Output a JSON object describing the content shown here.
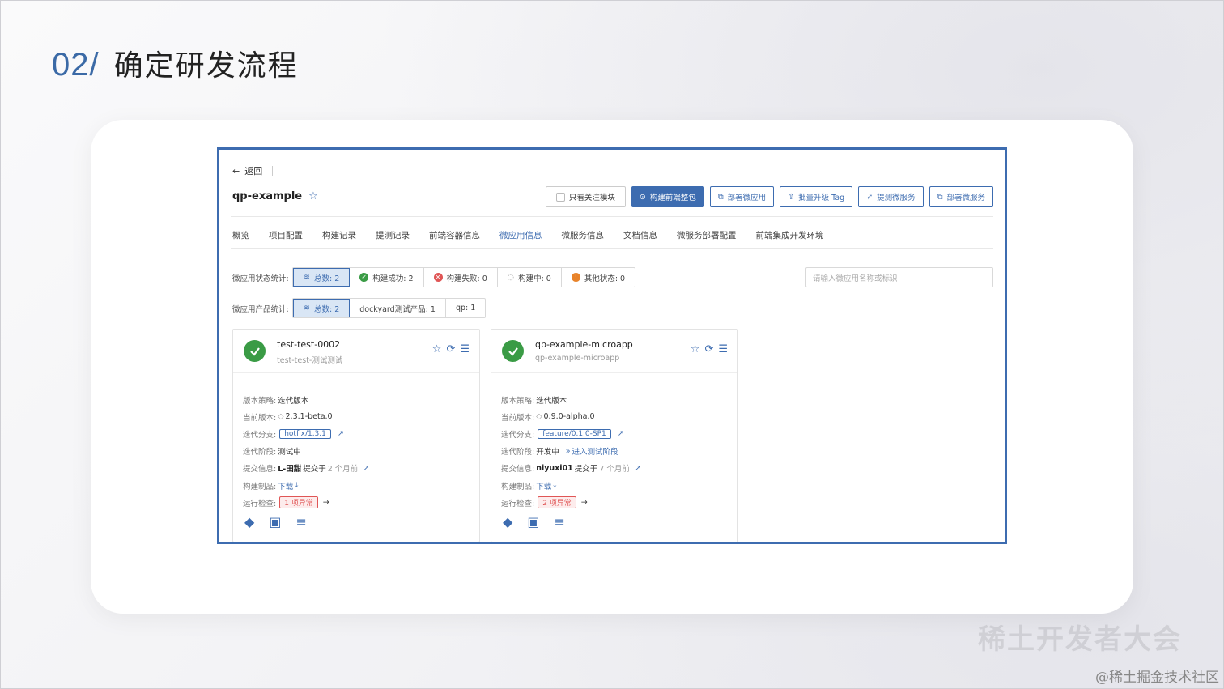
{
  "slide": {
    "number": "02/",
    "title": "确定研发流程"
  },
  "ui": {
    "back_label": "返回",
    "project_name": "qp-example",
    "actions": {
      "only_follow": "只看关注模块",
      "build_frontend": "构建前端整包",
      "deploy_microapp": "部署微应用",
      "batch_upgrade": "批量升级 Tag",
      "submit_test_service": "提测微服务",
      "deploy_microservice": "部署微服务"
    },
    "tabs": [
      "概览",
      "项目配置",
      "构建记录",
      "提测记录",
      "前端容器信息",
      "微应用信息",
      "微服务信息",
      "文档信息",
      "微服务部署配置",
      "前端集成开发环境"
    ],
    "active_tab": "微应用信息",
    "status_stats": {
      "label": "微应用状态统计:",
      "total": "总数: 2",
      "success": "构建成功: 2",
      "failed": "构建失败: 0",
      "building": "构建中: 0",
      "other": "其他状态: 0"
    },
    "product_stats": {
      "label": "微应用产品统计:",
      "total": "总数: 2",
      "dockyard": "dockyard测试产品: 1",
      "qp": "qp: 1"
    },
    "search_placeholder": "请输入微应用名称或标识",
    "cards": [
      {
        "name": "test-test-0002",
        "sub": "test-test-测试测试",
        "strategy_key": "版本策略:",
        "strategy": "迭代版本",
        "version_key": "当前版本:",
        "version": "2.3.1-beta.0",
        "branch_key": "迭代分支:",
        "branch": "hotfix/1.3.1",
        "stage_key": "迭代阶段:",
        "stage": "测试中",
        "stage_link": "",
        "commit_key": "提交信息:",
        "commit_user": "L-田甜",
        "commit_text": "提交于",
        "commit_time": "2 个月前",
        "artifact_key": "构建制品:",
        "artifact": "下载",
        "check_key": "运行检查:",
        "check": "1 项异常"
      },
      {
        "name": "qp-example-microapp",
        "sub": "qp-example-microapp",
        "strategy_key": "版本策略:",
        "strategy": "迭代版本",
        "version_key": "当前版本:",
        "version": "0.9.0-alpha.0",
        "branch_key": "迭代分支:",
        "branch": "feature/0.1.0-SP1",
        "stage_key": "迭代阶段:",
        "stage": "开发中",
        "stage_link": "进入测试阶段",
        "commit_key": "提交信息:",
        "commit_user": "niyuxi01",
        "commit_text": "提交于",
        "commit_time": "7 个月前",
        "artifact_key": "构建制品:",
        "artifact": "下载",
        "check_key": "运行检查:",
        "check": "2 项异常"
      }
    ]
  },
  "watermark": {
    "logo_text": "稀土开发者大会",
    "credit": "@稀土掘金技术社区"
  },
  "colors": {
    "accent": "#3d6cb0",
    "success": "#3a9b45",
    "danger": "#e05555",
    "warning": "#e8832a"
  }
}
